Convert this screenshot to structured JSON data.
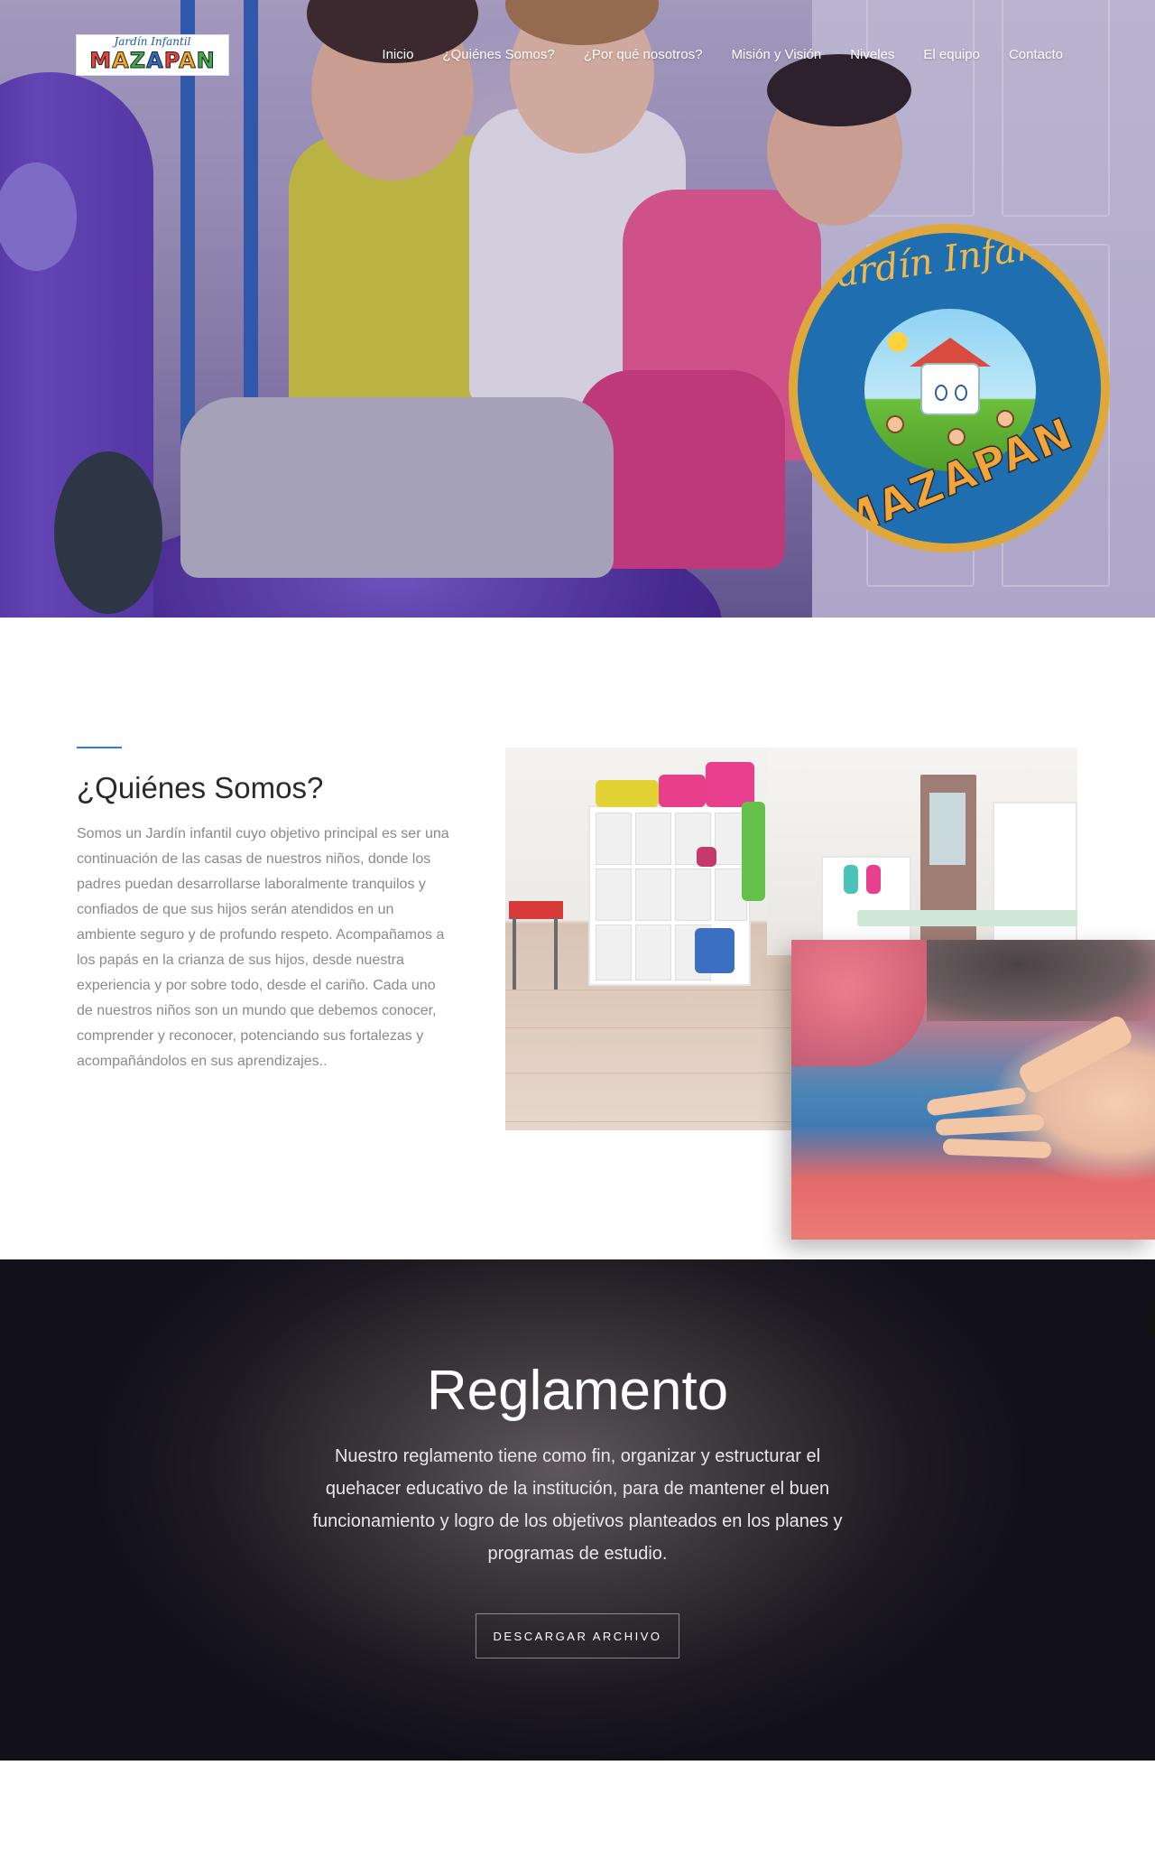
{
  "logo": {
    "top_text": "Jardín Infantil",
    "main_text": "MAZAPAN"
  },
  "nav": {
    "items": [
      {
        "label": "Inicio"
      },
      {
        "label": "¿Quiénes Somos?"
      },
      {
        "label": "¿Por qué nosotros?"
      },
      {
        "label": "Misión y Visión"
      },
      {
        "label": "Niveles"
      },
      {
        "label": "El equipo"
      },
      {
        "label": "Contacto"
      }
    ]
  },
  "hero": {
    "badge_top_text": "Jardín Infantil",
    "badge_bottom_text": "MAZAPAN"
  },
  "about": {
    "title": "¿Quiénes Somos?",
    "text": "Somos un Jardín infantil cuyo objetivo principal es ser una continuación de las casas de nuestros niños, donde los padres puedan desarrollarse laboralmente tranquilos y confiados de que sus hijos serán atendidos en un ambiente seguro y de profundo respeto. Acompañamos a los papás en la crianza de sus hijos, desde nuestra experiencia y por sobre todo, desde el cariño. Cada uno de nuestros niños son un mundo que debemos conocer, comprender y reconocer, potenciando sus fortalezas y acompañándolos en sus aprendizajes.."
  },
  "reglamento": {
    "title": "Reglamento",
    "text": "Nuestro reglamento tiene como fin, organizar y estructurar el quehacer educativo de la institución, para de mantener el buen funcionamiento y logro de los objetivos planteados en los planes y programas de estudio.",
    "button_label": "DESCARGAR ARCHIVO"
  },
  "colors": {
    "accent": "#2d7be5",
    "logo_letters": [
      "#e8403a",
      "#f5a623",
      "#3cae4a",
      "#2b6fc9",
      "#e8403a",
      "#f5a623",
      "#3cae4a"
    ]
  }
}
